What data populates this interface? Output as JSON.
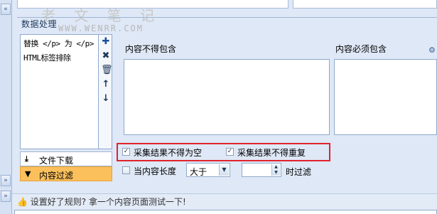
{
  "watermark": {
    "chinese": "老 文 笔 记",
    "url": "WWW.WENRR.COM"
  },
  "section": {
    "title": "数据处理"
  },
  "rules": {
    "items": [
      {
        "label": "替换 </p> 为 </p>"
      },
      {
        "label": "HTML标签排除"
      }
    ]
  },
  "toolbar": {
    "add_icon": "plus-icon",
    "delete_icon": "close-icon",
    "trash_icon": "trash-icon",
    "up_icon": "arrow-up-icon",
    "down_icon": "arrow-down-icon"
  },
  "nav": {
    "download_label": "文件下载",
    "filter_label": "内容过滤"
  },
  "filter": {
    "exclude_label": "内容不得包含",
    "include_label": "内容必须包含",
    "not_empty_label": "采集结果不得为空",
    "not_empty_checked": true,
    "no_duplicate_label": "采集结果不得重复",
    "no_duplicate_checked": true,
    "length_label": "当内容长度",
    "length_checked": false,
    "comparator": "大于",
    "length_value": "",
    "suffix_label": "时过滤"
  },
  "footer": {
    "hint": "设置好了规则? 拿一个内容页面测试一下!"
  },
  "colors": {
    "accent_orange": "#fbc05c",
    "highlight_red": "#e0232d",
    "panel_blue": "#dfe8f6"
  }
}
